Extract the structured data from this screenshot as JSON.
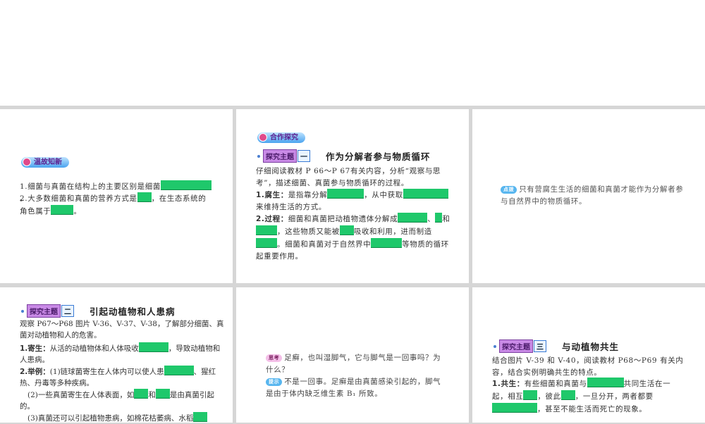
{
  "p1": {
    "badge": "温故知新",
    "l1": "1.细菌与真菌在结构上的主要区别是细菌",
    "l1e": "。",
    "l2a": "2.大多数细菌和真菌的营养方式是",
    "l2b": "，在生态系统的角色属于",
    "l2c": "。"
  },
  "p2": {
    "badge": "合作探究",
    "tag": "探究主题",
    "num": "一",
    "title": "作为分解者参与物质循环",
    "intro": "仔细阅读教材 P 66～P 67有关内容，分析“观察与思考”，描述细菌、真菌参与物质循环的过程。",
    "i1k": "1.腐生：",
    "i1a": "是指靠分解",
    "i1b": "，从中获取",
    "i1c": "来维持生活的方式。",
    "i2k": "2.过程：",
    "i2a": "细菌和真菌把动植物遗体分解成",
    "i2b": "、",
    "i2c": "和",
    "i2d": "，这些物质又能被",
    "i2e": "吸收和利用，进而制造",
    "i2f": "。细菌和真菌对于自然界中",
    "i2g": "等物质的循环起重要作用。"
  },
  "p3": {
    "pill": "点拨",
    "text": "只有营腐生生活的细菌和真菌才能作为分解者参与自然界中的物质循环。"
  },
  "p4": {
    "tag": "探究主题",
    "num": "二",
    "title": "引起动植物和人患病",
    "intro": "观察 P67～P68 图片 V-36、V-37、V-38，了解部分细菌、真菌对动植物和人的危害。",
    "i1k": "1.寄生：",
    "i1a": "从活的动植物体和人体吸收",
    "i1b": "，导致动植物和人患病。",
    "i2k": "2.举例：",
    "i2a": "(1)链球菌寄生在人体内可以使人患",
    "i2b": "、猩红热、丹毒等多种疾病。",
    "i2c": "(2)一些真菌寄生在人体表面，如",
    "i2d": "和",
    "i2e": "是由真菌引起的。",
    "i2f": "(3)真菌还可以引起植物患病，如棉花枯萎病、水稻"
  },
  "p5": {
    "pill1": "思考",
    "q": "足癣，也叫湿脚气，它与脚气是一回事吗？为什么？",
    "pill2": "提示",
    "a": "不是一回事。足癣是由真菌感染引起的，脚气是由于体内缺乏维生素 B₁ 所致。"
  },
  "p6": {
    "tag": "探究主题",
    "num": "三",
    "title": "与动植物共生",
    "intro": "结合图片 V-39 和 V-40，阅读教材 P68～P69 有关内容，结合实例明确共生的特点。",
    "i1k": "1.共生：",
    "i1a": "有些细菌和真菌与",
    "i1b": "共同生活在一起，相互",
    "i1c": "，彼此",
    "i1d": "，一旦分开，两者都要",
    "i1e": "，甚至不能生活而死亡的现象。"
  }
}
